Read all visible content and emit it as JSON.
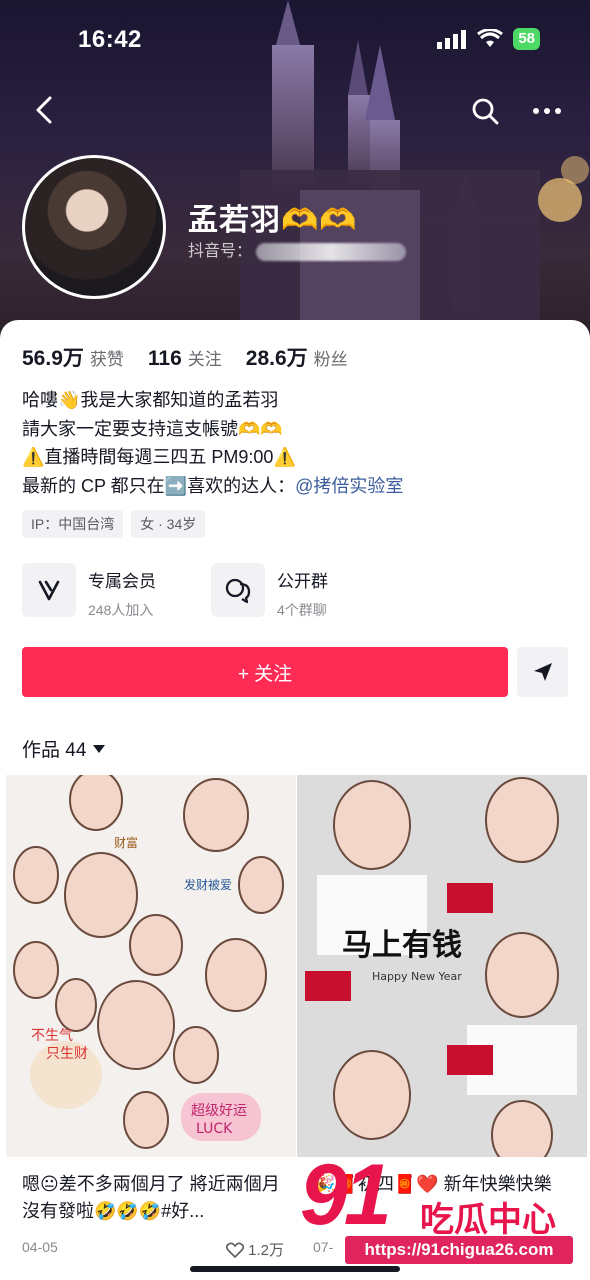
{
  "status_bar": {
    "time": "16:42",
    "battery": "58"
  },
  "nav": {
    "back_icon": "chevron-left-icon",
    "search_icon": "search-icon",
    "more_icon": "more-horizontal-icon"
  },
  "profile": {
    "name": "孟若羽🫶🫶",
    "douyin_id_label": "抖音号：",
    "stats": [
      {
        "num": "56.9万",
        "label": "获赞"
      },
      {
        "num": "116",
        "label": "关注"
      },
      {
        "num": "28.6万",
        "label": "粉丝"
      }
    ],
    "bio": {
      "line1": "哈嘍👋我是大家都知道的孟若羽",
      "line2": "請大家一定要支持這支帳號🫶🫶",
      "line3": "⚠️直播時間每週三四五 PM9:00⚠️",
      "line4_prefix": "最新的 CP 都只在➡️喜欢的达人：",
      "line4_mention": "@拷倍实验室"
    },
    "tags": [
      "IP：中国台湾",
      "女 · 34岁"
    ],
    "features": [
      {
        "title": "专属会员",
        "sub": "248人加入",
        "icon": "membership-v-icon"
      },
      {
        "title": "公开群",
        "sub": "4个群聊",
        "icon": "group-chat-icon"
      }
    ],
    "follow_label": "+ 关注",
    "message_icon": "send-message-icon"
  },
  "works": {
    "header": "作品 44",
    "items": [
      {
        "caption": "嗯😐差不多兩個月了 將近兩個月沒有發啦🤣🤣🤣#好...",
        "date": "04-05",
        "likes": "1.2万",
        "stickers": [
          "财富",
          "发财被爱",
          "不生气只生财",
          "超级好运 LUCK"
        ]
      },
      {
        "caption": "🎉🧧初四🧧❤️ 新年快樂快樂",
        "date": "07-",
        "likes": "",
        "stickers": [
          "马上有钱",
          "Happy New Year"
        ]
      }
    ]
  },
  "watermark": {
    "brand": "91",
    "brand_cn": "吃瓜中心",
    "url": "https://91chigua26.com"
  },
  "colors": {
    "accent": "#fe2c55",
    "mention": "#3a5c9e",
    "muted": "#8a8a90"
  }
}
